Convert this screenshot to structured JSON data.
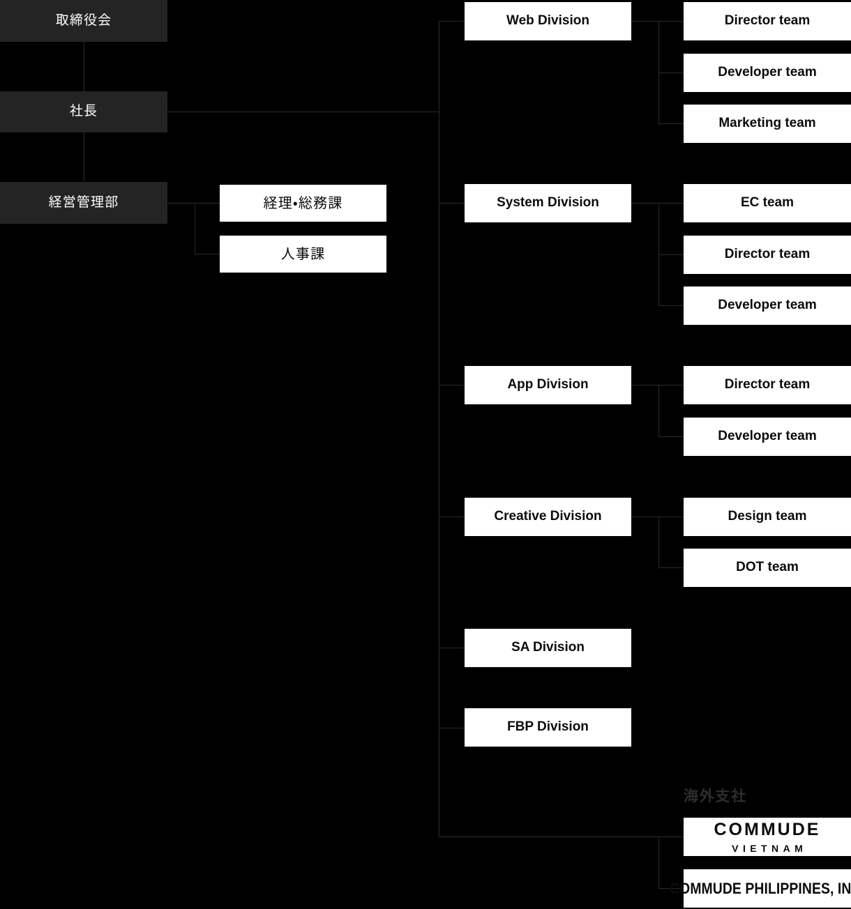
{
  "colors": {
    "background": "#000000",
    "dark_box": "#242424",
    "white_box": "#ffffff",
    "line": "#2b2b2b",
    "dark_text": "#0c0c0c",
    "light_text": "#ffffff",
    "section_label": "#2e2e2e"
  },
  "executive": {
    "board_of_directors": "取締役会",
    "president": "社長",
    "management_department": "経営管理部"
  },
  "management_sections": [
    {
      "label": "経理・総務課"
    },
    {
      "label": "人事課"
    }
  ],
  "divisions": [
    {
      "label": "Web Division",
      "teams": [
        {
          "label": "Director team"
        },
        {
          "label": "Developer team"
        },
        {
          "label": "Marketing team"
        }
      ]
    },
    {
      "label": "System Division",
      "teams": [
        {
          "label": "EC team"
        },
        {
          "label": "Director team"
        },
        {
          "label": "Developer team"
        }
      ]
    },
    {
      "label": "App Division",
      "teams": [
        {
          "label": "Director team"
        },
        {
          "label": "Developer team"
        }
      ]
    },
    {
      "label": "Creative Division",
      "teams": [
        {
          "label": "Design team"
        },
        {
          "label": "DOT team"
        }
      ]
    },
    {
      "label": "SA Division",
      "teams": []
    },
    {
      "label": "FBP Division",
      "teams": []
    }
  ],
  "overseas": {
    "heading": "海外支社",
    "branches": [
      {
        "main": "COMMUDE",
        "sub": "VIETNAM"
      },
      {
        "main": "COMMUDE PHILIPPINES, INC."
      }
    ]
  }
}
